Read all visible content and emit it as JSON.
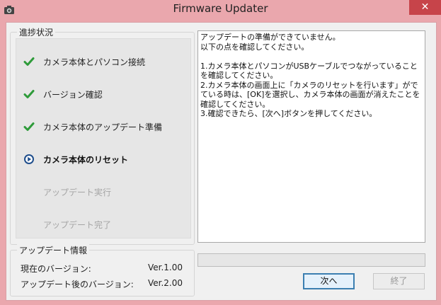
{
  "window": {
    "title": "Firmware Updater",
    "close_symbol": "✕"
  },
  "progress_group": {
    "label": "進捗状況",
    "steps": [
      {
        "label": "カメラ本体とパソコン接続",
        "state": "done",
        "icon": "check-icon"
      },
      {
        "label": "バージョン確認",
        "state": "done",
        "icon": "check-icon"
      },
      {
        "label": "カメラ本体のアップデート準備",
        "state": "done",
        "icon": "check-icon"
      },
      {
        "label": "カメラ本体のリセット",
        "state": "current",
        "icon": "play-circle-icon"
      },
      {
        "label": "アップデート実行",
        "state": "pending",
        "icon": ""
      },
      {
        "label": "アップデート完了",
        "state": "pending",
        "icon": ""
      }
    ]
  },
  "message": {
    "text": "アップデートの準備ができていません。\n以下の点を確認してください。\n\n1.カメラ本体とパソコンがUSBケーブルでつながっていることを確認してください。\n2.カメラ本体の画面上に「カメラのリセットを行います」がでている時は、[OK]を選択し、カメラ本体の画面が消えたことを確認してください。\n3.確認できたら、[次へ]ボタンを押してください。"
  },
  "info_group": {
    "label": "アップデート情報",
    "current_version_label": "現在のバージョン:",
    "current_version_value": "Ver.1.00",
    "new_version_label": "アップデート後のバージョン:",
    "new_version_value": "Ver.2.00"
  },
  "progress": {
    "fraction": 0
  },
  "buttons": {
    "next_label": "次へ",
    "exit_label": "終了"
  },
  "colors": {
    "title_bar": "#eaa7ad",
    "close_button": "#c7444a",
    "check": "#2e9b3a",
    "current_step": "#1f4e8c",
    "pending_text": "#a5a5a5"
  }
}
